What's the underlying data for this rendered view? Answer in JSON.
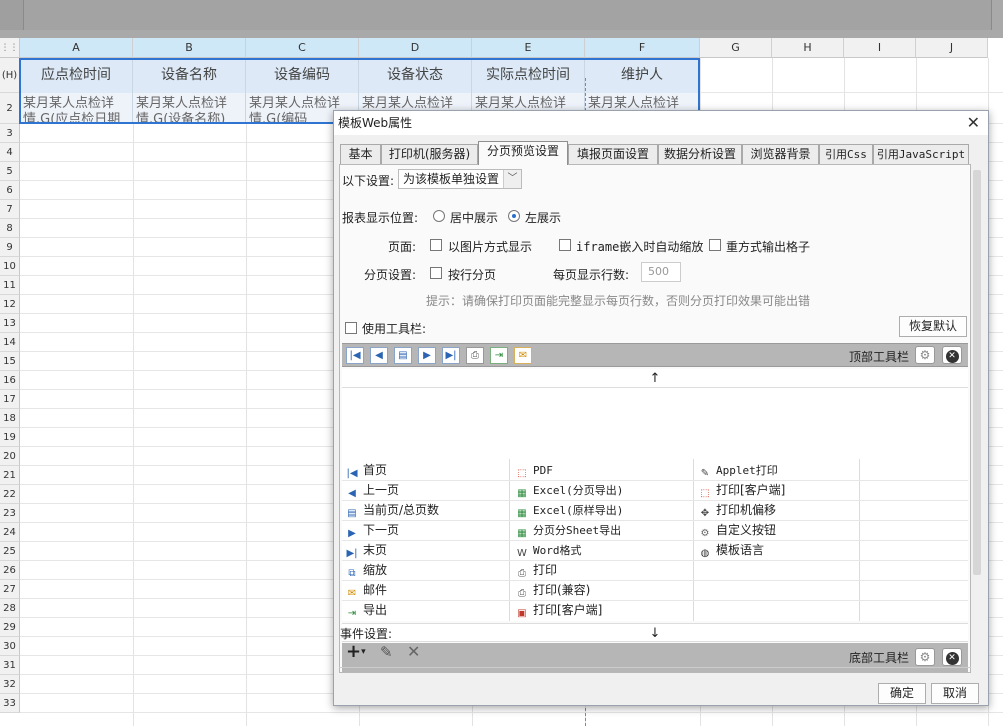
{
  "sheet": {
    "columns": [
      "A",
      "B",
      "C",
      "D",
      "E",
      "F",
      "G",
      "H",
      "I",
      "J"
    ],
    "rows": [
      "(H)",
      "2",
      "3",
      "4",
      "5",
      "6",
      "7",
      "8",
      "9",
      "10",
      "11",
      "12",
      "13",
      "14",
      "15",
      "16",
      "17",
      "18",
      "19",
      "20",
      "21",
      "22",
      "23",
      "24",
      "25",
      "26",
      "27",
      "28",
      "29",
      "30",
      "31",
      "32",
      "33"
    ],
    "header_cells": [
      "应点检时间",
      "设备名称",
      "设备编码",
      "设备状态",
      "实际点检时间",
      "维护人"
    ],
    "data_cells": [
      {
        "line1": "某月某人点检详",
        "line2": "情.G(应点检日期"
      },
      {
        "line1": "某月某人点检详",
        "line2": "情.G(设备名称)"
      },
      {
        "line1": "某月某人点检详",
        "line2": "情.G(编码"
      },
      {
        "line1": "某月某人点检详",
        "line2": ""
      },
      {
        "line1": "某月某人点检详",
        "line2": ""
      },
      {
        "line1": "某月某人点检详",
        "line2": ""
      }
    ]
  },
  "dialog": {
    "title": "模板Web属性",
    "tabs": [
      "基本",
      "打印机(服务器)",
      "分页预览设置",
      "填报页面设置",
      "数据分析设置",
      "浏览器背景",
      "引用Css",
      "引用JavaScript"
    ],
    "active_tab": 2,
    "settings_label": "以下设置:",
    "settings_value": "为该模板单独设置",
    "display_position_label": "报表显示位置:",
    "center_label": "居中展示",
    "left_label": "左展示",
    "page_label": "页面:",
    "image_mode_label": "以图片方式显示",
    "iframe_label": "iframe嵌入时自动缩放",
    "repeat_label": "重方式输出格子",
    "paging_label": "分页设置:",
    "row_paging_label": "按行分页",
    "rows_per_page_label": "每页显示行数:",
    "rows_per_page_value": "500",
    "hint": "提示：请确保打印页面能完整显示每页行数，否则分页打印效果可能出错",
    "use_toolbar_label": "使用工具栏:",
    "restore_default": "恢复默认",
    "top_toolbar_label": "顶部工具栏",
    "bottom_toolbar_label": "底部工具栏",
    "up_arrow": "↑",
    "down_arrow": "↓",
    "items_col1": [
      "首页",
      "上一页",
      "当前页/总页数",
      "下一页",
      "末页",
      "缩放",
      "邮件",
      "导出"
    ],
    "items_col2": [
      "PDF",
      "Excel(分页导出)",
      "Excel(原样导出)",
      "分页分Sheet导出",
      "Word格式",
      "打印",
      "打印(兼容)",
      "打印[客户端]"
    ],
    "items_col3": [
      "Applet打印",
      "打印[客户端]",
      "打印机偏移",
      "自定义按钮",
      "模板语言"
    ],
    "event_label": "事件设置:",
    "ok": "确定",
    "cancel": "取消"
  },
  "colors": {
    "accent": "#2f74d0",
    "header_fill": "#dde9f6",
    "toolbar_gray": "#b6b6b6"
  }
}
